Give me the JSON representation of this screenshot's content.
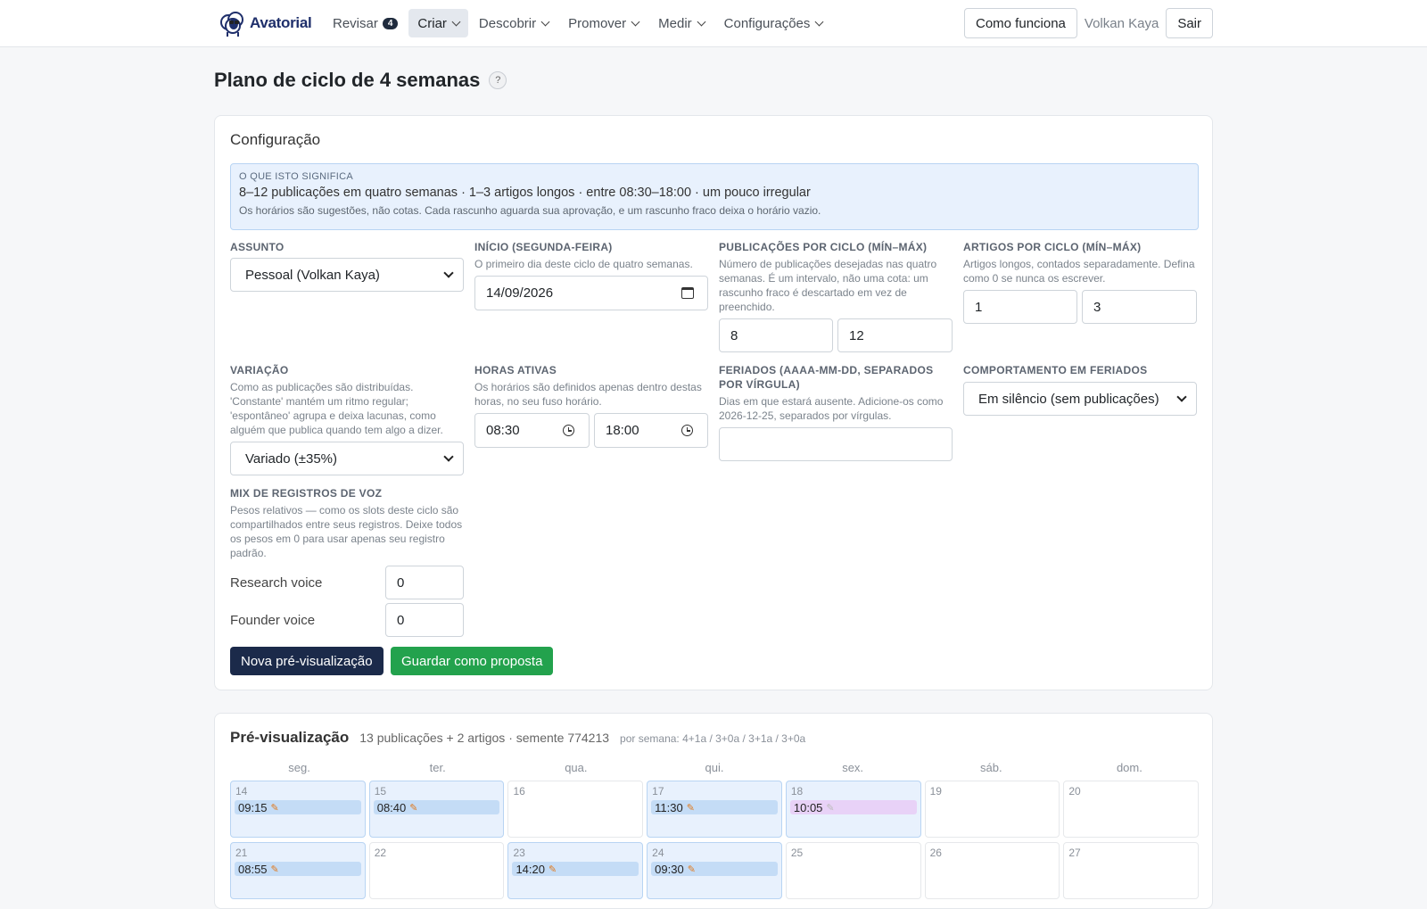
{
  "brand": {
    "name": "Avatorial"
  },
  "nav": {
    "revisar": "Revisar",
    "revisar_badge": "4",
    "criar": "Criar",
    "descobrir": "Descobrir",
    "promover": "Promover",
    "medir": "Medir",
    "configuracoes": "Configurações"
  },
  "header_right": {
    "como_funciona": "Como funciona",
    "user": "Volkan Kaya",
    "sair": "Sair"
  },
  "page": {
    "title": "Plano de ciclo de 4 semanas",
    "help": "?"
  },
  "config": {
    "title": "Configuração",
    "info": {
      "kicker": "O QUE ISTO SIGNIFICA",
      "main": "8–12 publicações em quatro semanas · 1–3 artigos longos · entre 08:30–18:00 · um pouco irregular",
      "sub": "Os horários são sugestões, não cotas. Cada rascunho aguarda sua aprovação, e um rascunho fraco deixa o horário vazio."
    },
    "assunto": {
      "label": "Assunto",
      "value": "Pessoal (Volkan Kaya)"
    },
    "inicio": {
      "label": "Início (segunda-feira)",
      "help": "O primeiro dia deste ciclo de quatro semanas.",
      "value": "14/09/2026"
    },
    "publicacoes": {
      "label": "Publicações por ciclo (mín–máx)",
      "help": "Número de publicações desejadas nas quatro semanas. É um intervalo, não uma cota: um rascunho fraco é descartado em vez de preenchido.",
      "min": "8",
      "max": "12"
    },
    "artigos": {
      "label": "Artigos por ciclo (mín–máx)",
      "help": "Artigos longos, contados separadamente. Defina como 0 se nunca os escrever.",
      "min": "1",
      "max": "3"
    },
    "variacao": {
      "label": "Variação",
      "help": "Como as publicações são distribuídas. 'Constante' mantém um ritmo regular; 'espontâneo' agrupa e deixa lacunas, como alguém que publica quando tem algo a dizer.",
      "value": "Variado (±35%)"
    },
    "horas": {
      "label": "Horas ativas",
      "help": "Os horários são definidos apenas dentro destas horas, no seu fuso horário.",
      "start": "08:30",
      "end": "18:00"
    },
    "feriados": {
      "label": "Feriados (AAAA-MM-DD, separados por vírgula)",
      "help": "Dias em que estará ausente. Adicione-os como 2026-12-25, separados por vírgulas.",
      "value": ""
    },
    "comportamento": {
      "label": "Comportamento em feriados",
      "value": "Em silêncio (sem publicações)"
    },
    "mix": {
      "label": "Mix de registros de voz",
      "help": "Pesos relativos — como os slots deste ciclo são compartilhados entre seus registros. Deixe todos os pesos em 0 para usar apenas seu registro padrão.",
      "voices": [
        {
          "name": "Research voice",
          "weight": "0"
        },
        {
          "name": "Founder voice",
          "weight": "0"
        }
      ]
    },
    "buttons": {
      "preview": "Nova pré-visualização",
      "save": "Guardar como proposta"
    }
  },
  "preview": {
    "title": "Pré-visualização",
    "summary": "13 publicações + 2 artigos · semente 774213",
    "weekly": "por semana: 4+1a / 3+0a / 3+1a / 3+0a",
    "weekdays": [
      "seg.",
      "ter.",
      "qua.",
      "qui.",
      "sex.",
      "sáb.",
      "dom."
    ],
    "weeks": [
      [
        {
          "day": "14",
          "time": "09:15",
          "kind": "post"
        },
        {
          "day": "15",
          "time": "08:40",
          "kind": "post"
        },
        {
          "day": "16"
        },
        {
          "day": "17",
          "time": "11:30",
          "kind": "post"
        },
        {
          "day": "18",
          "time": "10:05",
          "kind": "article"
        },
        {
          "day": "19"
        },
        {
          "day": "20"
        }
      ],
      [
        {
          "day": "21",
          "time": "08:55",
          "kind": "post"
        },
        {
          "day": "22"
        },
        {
          "day": "23",
          "time": "14:20",
          "kind": "post"
        },
        {
          "day": "24",
          "time": "09:30",
          "kind": "post"
        },
        {
          "day": "25"
        },
        {
          "day": "26"
        },
        {
          "day": "27"
        }
      ]
    ]
  }
}
